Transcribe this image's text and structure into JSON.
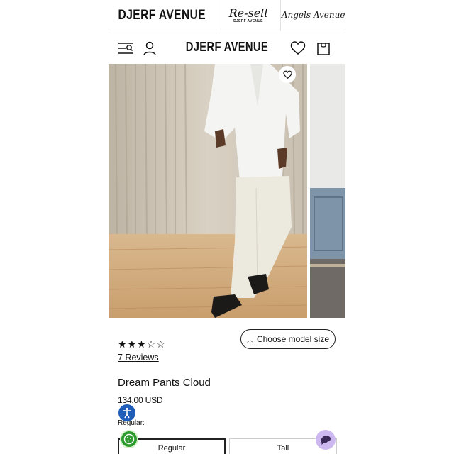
{
  "brand_switcher": {
    "items": [
      {
        "label": "DJERF AVENUE"
      },
      {
        "label": "Re-sell",
        "sublabel": "DJERF AVENUE"
      },
      {
        "label": "Angels Avenue"
      }
    ]
  },
  "header": {
    "logo": "DJERF AVENUE",
    "icons": [
      "menu-search-icon",
      "account-icon",
      "wishlist-heart-icon",
      "cart-bag-icon"
    ]
  },
  "gallery": {
    "wishlist_icon": "heart-icon"
  },
  "product": {
    "rating_stars": [
      "★",
      "★",
      "★",
      "☆",
      "☆"
    ],
    "rating": 3,
    "rating_max": 5,
    "reviews_label": "7 Reviews",
    "choose_model_label": "Choose model size",
    "title": "Dream Pants Cloud",
    "price": "134.00 USD",
    "fit_label": "Regular:",
    "fit_options": [
      {
        "label": "Regular",
        "selected": true
      },
      {
        "label": "Tall",
        "selected": false
      }
    ]
  },
  "widgets": {
    "accessibility_icon": "accessibility-icon",
    "cookie_icon": "cookie-icon",
    "chat_icon": "chat-icon",
    "chat_color": "#cdb8ef",
    "accessibility_color": "#1f5db8",
    "cookie_color": "#2e9b2e"
  }
}
